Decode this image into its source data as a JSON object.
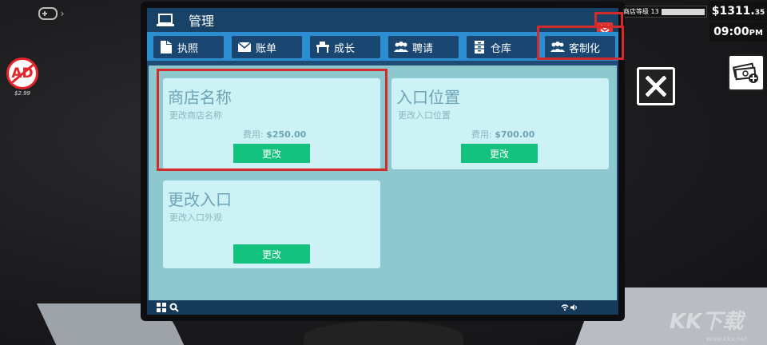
{
  "hud": {
    "ad_price": "$2.99",
    "store_level_label": "商店等级",
    "store_level_value": "13",
    "money_main": "$1311.",
    "money_cents": "35",
    "time": "09:00",
    "time_suffix": "PM"
  },
  "window": {
    "title": "管理"
  },
  "tabs": [
    {
      "label": "执照",
      "icon": "license-icon"
    },
    {
      "label": "账单",
      "icon": "bill-icon"
    },
    {
      "label": "成长",
      "icon": "desk-icon"
    },
    {
      "label": "聘请",
      "icon": "people-icon"
    },
    {
      "label": "仓库",
      "icon": "cabinet-icon"
    },
    {
      "label": "客制化",
      "icon": "people-icon"
    }
  ],
  "cards": [
    {
      "title": "商店名称",
      "subtitle": "更改商店名称",
      "fee_label": "费用:",
      "fee_amount": "$250.00",
      "button": "更改"
    },
    {
      "title": "入口位置",
      "subtitle": "更改入口位置",
      "fee_label": "费用:",
      "fee_amount": "$700.00",
      "button": "更改"
    },
    {
      "title": "更改入口",
      "subtitle": "更改入口外观",
      "button": "更改"
    }
  ],
  "watermark": {
    "text": "KK下载",
    "sub": "www.kkx.net"
  },
  "colors": {
    "accent_green": "#13c27e",
    "highlight_red": "#d42a2a",
    "tab_strip": "#2c8ed0",
    "tab_bg": "#1a4772",
    "content_bg": "#8cc8cd",
    "card_bg": "#cdf2f5"
  }
}
